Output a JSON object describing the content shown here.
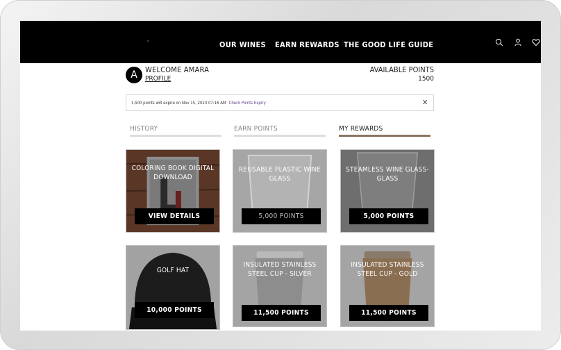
{
  "nav": {
    "items": [
      "OUR WINES",
      "EARN REWARDS",
      "THE GOOD LIFE GUIDE"
    ],
    "icons": [
      "search-icon",
      "user-icon",
      "heart-icon"
    ]
  },
  "account": {
    "avatar_letter": "A",
    "welcome": "WELCOME AMARA",
    "profile_link": "PROFILE",
    "available_label": "AVAILABLE POINTS",
    "available_value": "1500"
  },
  "notice": {
    "text": "1,500 points will expire on Nov 15, 2023 07:16 AM",
    "link": "Check Points Expiry",
    "close": "✕"
  },
  "tabs": [
    {
      "label": "HISTORY",
      "active": false
    },
    {
      "label": "EARN POINTS",
      "active": false
    },
    {
      "label": "MY REWARDS",
      "active": true
    }
  ],
  "colors": {
    "header_bg": "#000000",
    "tab_active_line": "#8a7560",
    "tab_inactive_line": "#dddddd",
    "notice_link": "#5b3b86"
  },
  "rewards": [
    {
      "title": "COLORING BOOK DIGITAL DOWNLOAD",
      "button": "VIEW DETAILS",
      "image": "coloring-book-image"
    },
    {
      "title": "REUSABLE PLASTIC WINE GLASS",
      "button": "5,000 POINTS",
      "image": "plastic-wine-glass-image"
    },
    {
      "title": "STEAMLESS WINE GLASS-GLASS",
      "button": "5,000 POINTS",
      "image": "stemless-wine-glass-image"
    },
    {
      "title": "GOLF HAT",
      "button": "10,000 POINTS",
      "image": "golf-hat-image"
    },
    {
      "title": "INSULATED STAINLESS STEEL CUP - SILVER",
      "button": "11,500 POINTS",
      "image": "silver-cup-image"
    },
    {
      "title": "INSULATED STAINLESS STEEL CUP - GOLD",
      "button": "11,500 POINTS",
      "image": "gold-cup-image"
    }
  ]
}
